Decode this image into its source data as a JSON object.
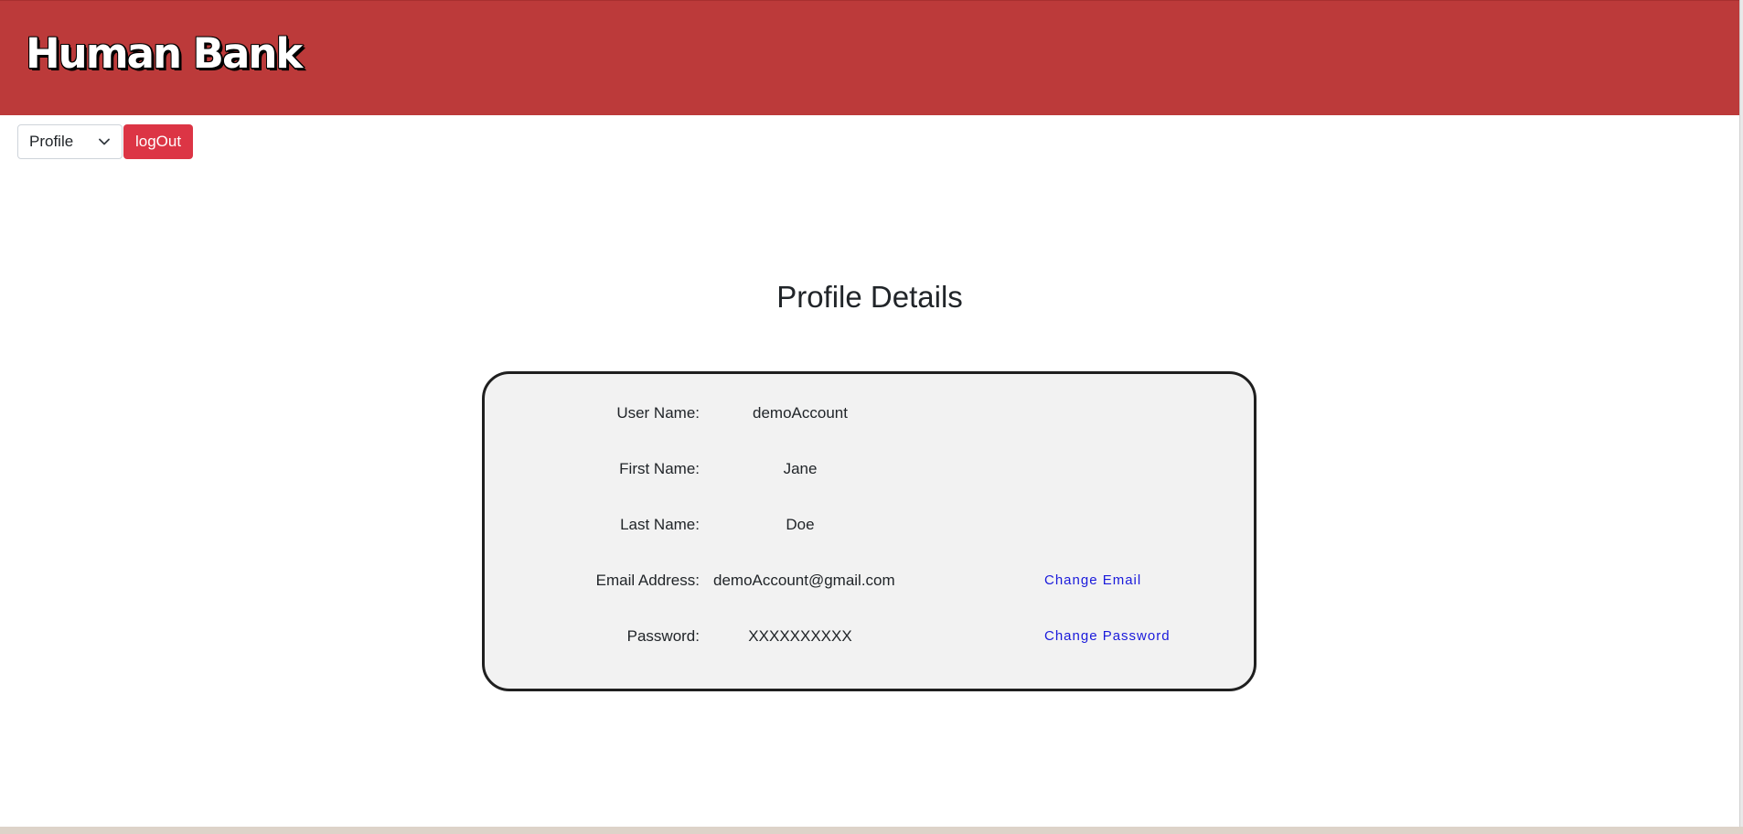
{
  "header": {
    "brand": "Human Bank"
  },
  "nav": {
    "select_value": "Profile",
    "select_icon": "chevron-down-icon",
    "logout_label": "logOut"
  },
  "main": {
    "title": "Profile Details",
    "fields": [
      {
        "label": "User Name:",
        "value": "demoAccount"
      },
      {
        "label": "First Name:",
        "value": "Jane"
      },
      {
        "label": "Last Name:",
        "value": "Doe"
      },
      {
        "label": "Email Address:",
        "value": "demoAccount@gmail.com",
        "action": "Change Email"
      },
      {
        "label": "Password:",
        "value": "XXXXXXXXXX",
        "action": "Change Password"
      }
    ]
  },
  "colors": {
    "header_bg": "#bc3a3a",
    "logout_bg": "#dc3545",
    "card_bg": "#f2f2f2",
    "link": "#1a1adb"
  }
}
